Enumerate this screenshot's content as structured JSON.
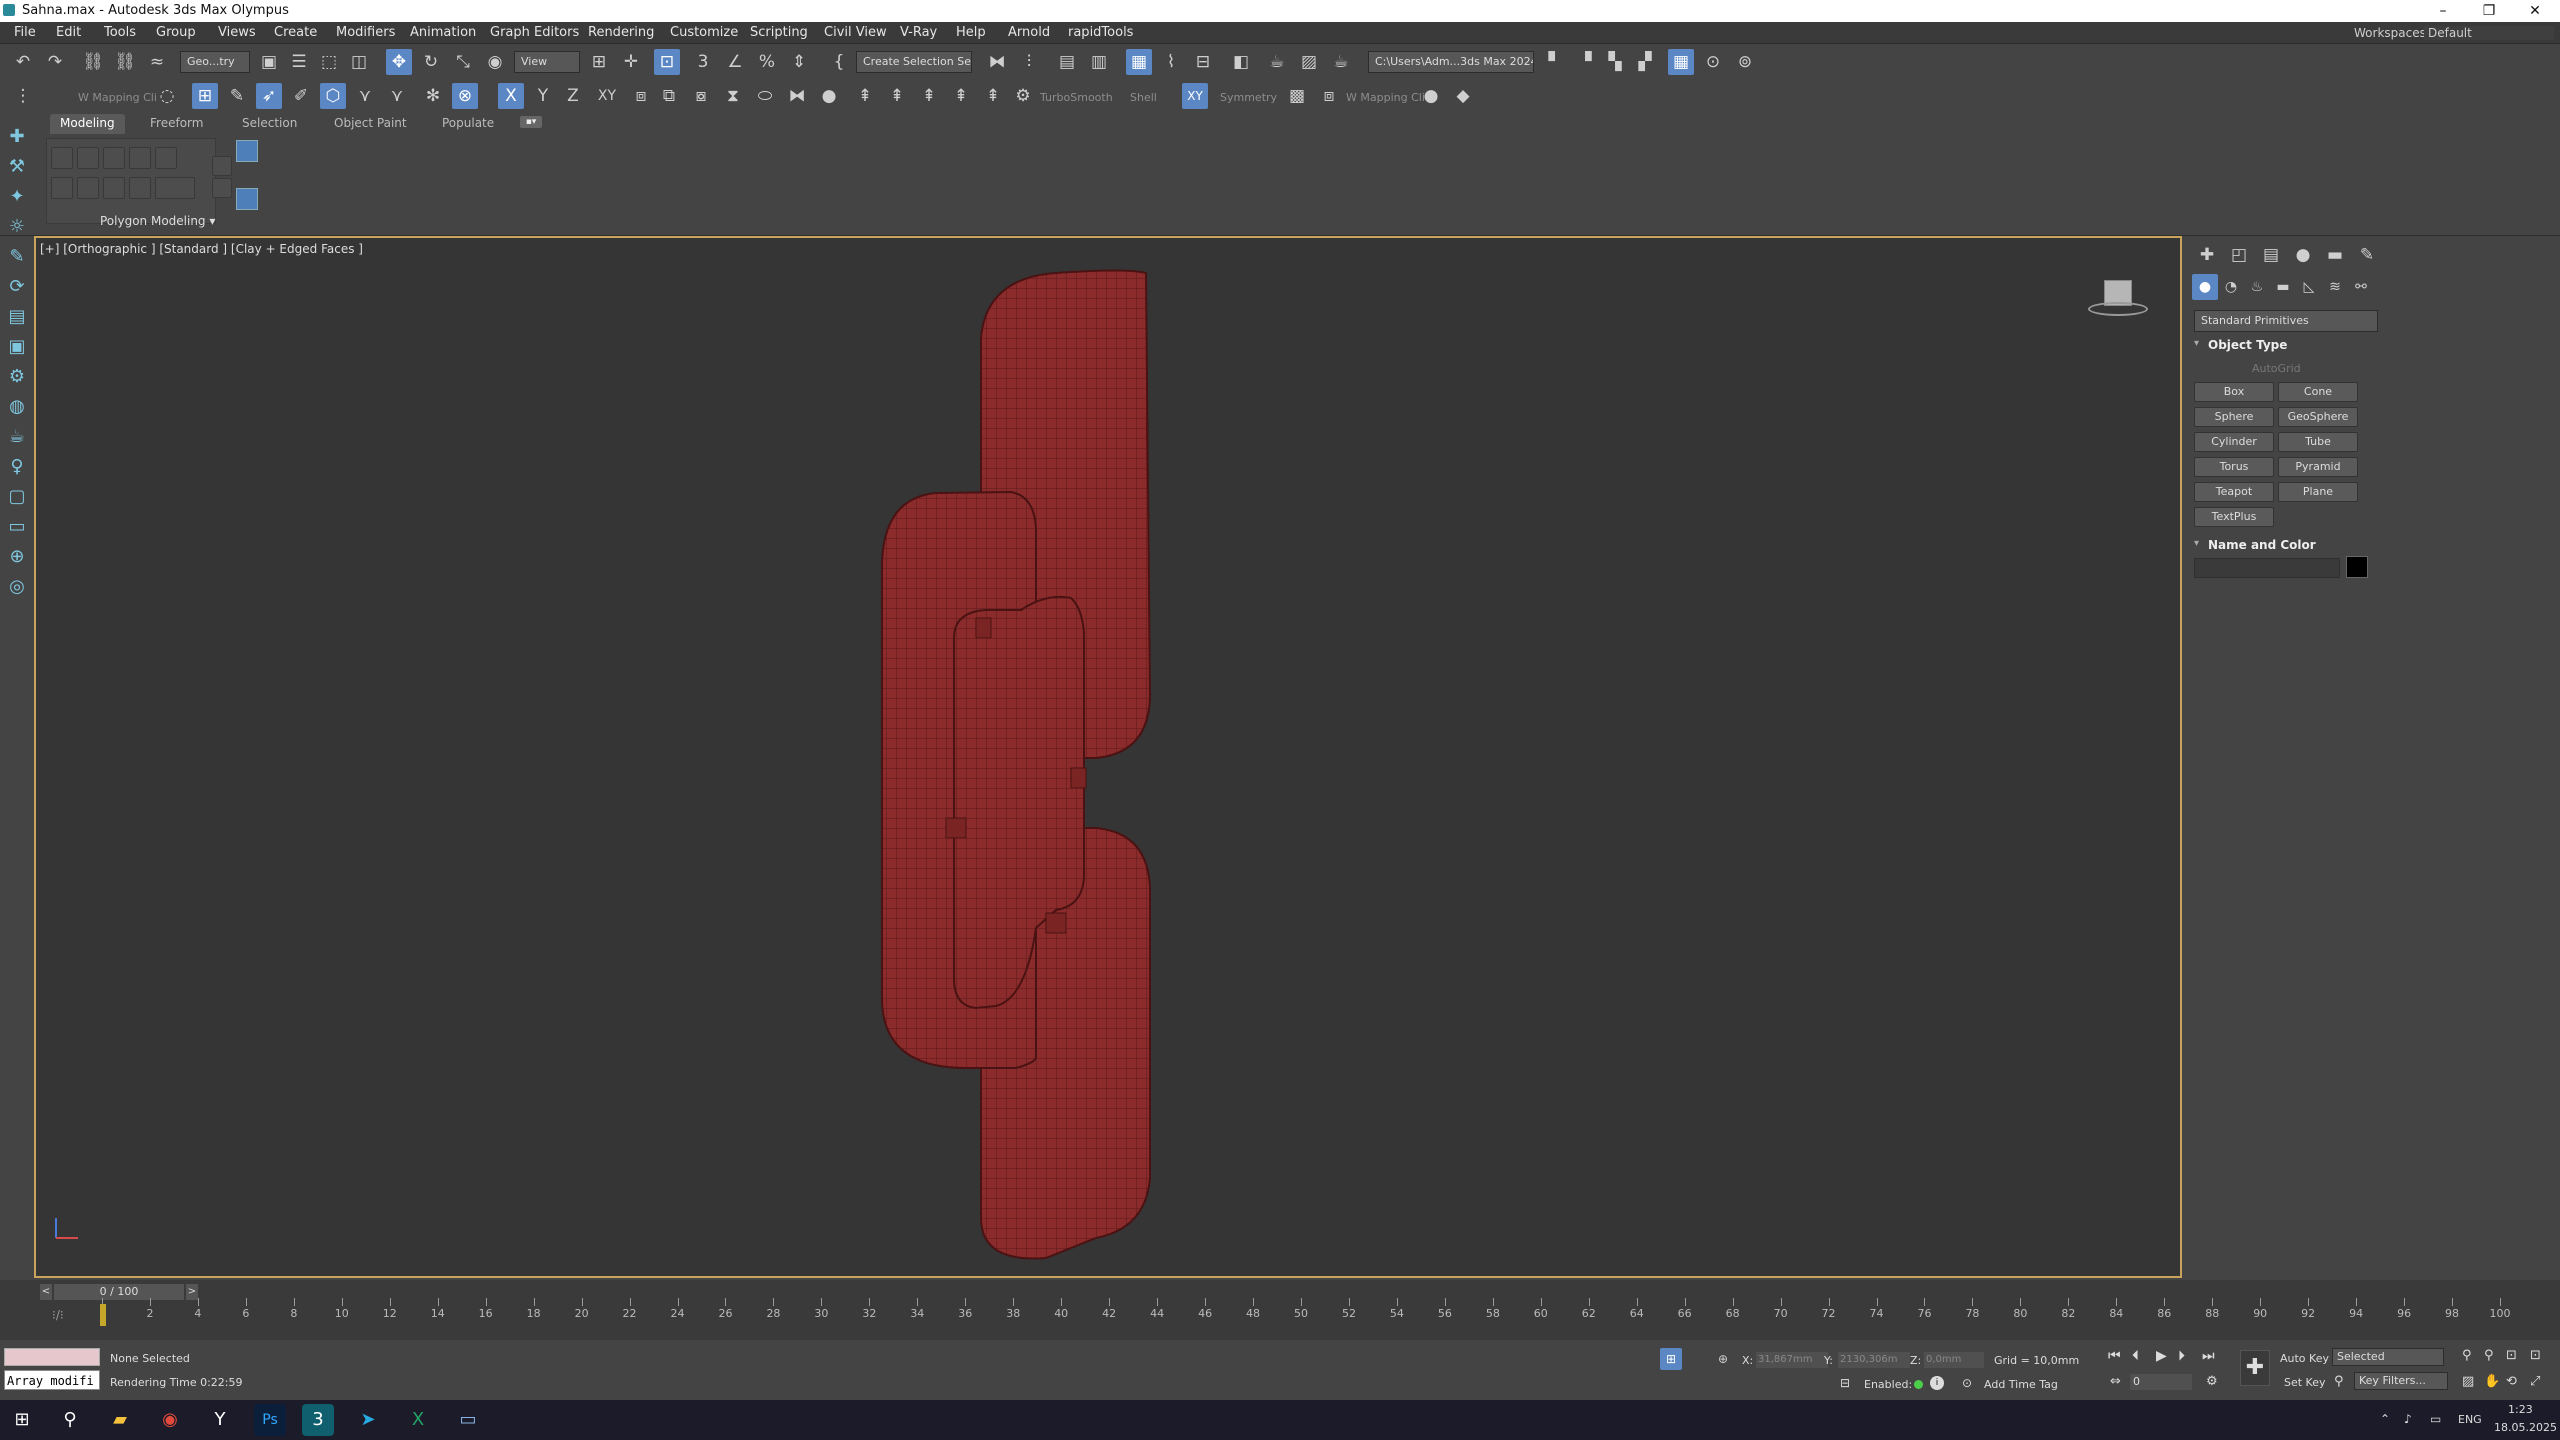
{
  "window": {
    "title": "Sahna.max - Autodesk 3ds Max Olympus",
    "minimize": "–",
    "restore": "❐",
    "close": "✕"
  },
  "menu": {
    "items": [
      "File",
      "Edit",
      "Tools",
      "Group",
      "Views",
      "Create",
      "Modifiers",
      "Animation",
      "Graph Editors",
      "Rendering",
      "Customize",
      "Scripting",
      "Civil View",
      "V-Ray",
      "Help",
      "Arnold",
      "rapidTools"
    ],
    "workspaces_label": "Workspaces:",
    "workspaces_value": "Default"
  },
  "toolbar1": {
    "selection_filter": "Geo...try",
    "ref_coord": "View",
    "named_selection": "Create Selection Se",
    "project_path": "C:\\Users\\Adm...3ds Max 2024"
  },
  "toolbar2": {
    "mapping_label_1": "W Mapping Cli",
    "turbosmooth": "TurboSmooth",
    "shell": "Shell",
    "symmetry": "Symmetry",
    "mapping_label_2": "W Mapping Cli"
  },
  "ribbon": {
    "tabs": [
      "Modeling",
      "Freeform",
      "Selection",
      "Object Paint",
      "Populate"
    ],
    "panel_label": "Polygon Modeling ▾"
  },
  "viewport": {
    "label": "[+] [Orthographic ] [Standard ] [Clay + Edged Faces ]",
    "mesh_color": "#8b2b2b",
    "wire_color": "#5a1818"
  },
  "command_panel": {
    "category": "Standard Primitives",
    "object_type_title": "Object Type",
    "autogrid": "AutoGrid",
    "primitives": [
      "Box",
      "Cone",
      "Sphere",
      "GeoSphere",
      "Cylinder",
      "Tube",
      "Torus",
      "Pyramid",
      "Teapot",
      "Plane",
      "TextPlus"
    ],
    "name_color_title": "Name and Color"
  },
  "timeline": {
    "frame": "0 / 100",
    "ticks": [
      "0",
      "2",
      "4",
      "6",
      "8",
      "10",
      "12",
      "14",
      "16",
      "18",
      "20",
      "22",
      "24",
      "26",
      "28",
      "30",
      "32",
      "34",
      "36",
      "38",
      "40",
      "42",
      "44",
      "46",
      "48",
      "50",
      "52",
      "54",
      "56",
      "58",
      "60",
      "62",
      "64",
      "66",
      "68",
      "70",
      "72",
      "74",
      "76",
      "78",
      "80",
      "82",
      "84",
      "86",
      "88",
      "90",
      "92",
      "94",
      "96",
      "98",
      "100"
    ]
  },
  "status": {
    "maxscript": "Array modifi",
    "selection": "None Selected",
    "render_time": "Rendering Time  0:22:59",
    "x_label": "X:",
    "x_value": "31,867mm",
    "y_label": "Y:",
    "y_value": "2130,306m",
    "z_label": "Z:",
    "z_value": "0,0mm",
    "grid": "Grid = 10,0mm",
    "enabled": "Enabled:",
    "add_time_tag": "Add Time Tag",
    "auto_key": "Auto Key",
    "set_key": "Set Key",
    "key_mode": "Selected",
    "key_filters": "Key Filters...",
    "frame_input": "0"
  },
  "taskbar": {
    "lang": "ENG",
    "time": "1:23",
    "date": "18.05.2025"
  }
}
